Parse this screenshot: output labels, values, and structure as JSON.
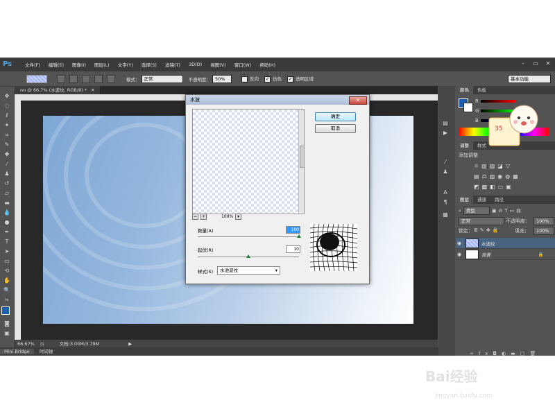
{
  "app": {
    "logo": "Ps"
  },
  "menu": [
    "文件(F)",
    "编辑(E)",
    "图像(I)",
    "图层(L)",
    "文字(Y)",
    "选择(S)",
    "滤镜(T)",
    "3D(D)",
    "视图(V)",
    "窗口(W)",
    "帮助(H)"
  ],
  "window_controls": [
    "–",
    "▭",
    "✕"
  ],
  "options": {
    "mode_label": "模式：",
    "mode_value": "正常",
    "opacity_label": "不透明度：",
    "opacity_value": "50%",
    "reverse_label": "反向",
    "dither_label": "仿色",
    "transparency_label": "透明区域",
    "workspace": "基本功能"
  },
  "document": {
    "tab_title": "nn @ 66.7% (水波纹, RGB/8) *",
    "zoom": "66.67%",
    "doc_info": "文档:3.00M/3.79M"
  },
  "bottom_tabs": [
    "Mini Bridge",
    "时间轴"
  ],
  "panels": {
    "color_tabs": [
      "颜色",
      "色板"
    ],
    "color_channels": [
      "R",
      "G",
      "B"
    ],
    "adjust_tabs": [
      "调整",
      "样式"
    ],
    "adjust_title": "添加调整",
    "layers_tabs": [
      "图层",
      "通道",
      "路径"
    ],
    "layer_filter": "类型",
    "blend_mode": "正常",
    "opacity_label": "不透明度：",
    "opacity_value": "100%",
    "lock_label": "锁定：",
    "fill_label": "填充：",
    "fill_value": "100%",
    "layers": [
      {
        "name": "水波纹",
        "selected": true
      },
      {
        "name": "背景",
        "selected": false
      }
    ]
  },
  "dialog": {
    "title": "水波",
    "ok": "确定",
    "cancel": "取消",
    "zoom": "100%",
    "amount_label": "数量(A)",
    "amount_value": "100",
    "ridges_label": "起伏(R)",
    "ridges_value": "10",
    "style_label": "样式(S)",
    "style_value": "水池波纹"
  },
  "watermark": {
    "brand": "Bai经验",
    "url": "jingyan.baidu.com"
  },
  "colors": {
    "fg": "#1b5fb0",
    "bg": "#ffffff",
    "accent": "#3399ff"
  }
}
